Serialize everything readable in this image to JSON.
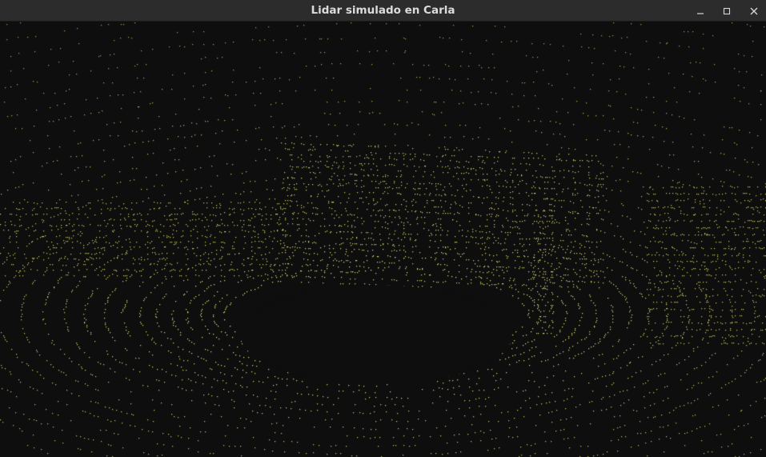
{
  "window": {
    "title": "Lidar simulado en Carla",
    "controls": {
      "minimize_icon": "minimize-icon",
      "maximize_icon": "maximize-icon",
      "close_icon": "close-icon"
    }
  },
  "viewport": {
    "background_color": "#0e0e0e",
    "point_color": "#e6e87a"
  },
  "colors": {
    "titlebar_bg": "#2c2c2c",
    "title_text": "#dcdcdc"
  }
}
